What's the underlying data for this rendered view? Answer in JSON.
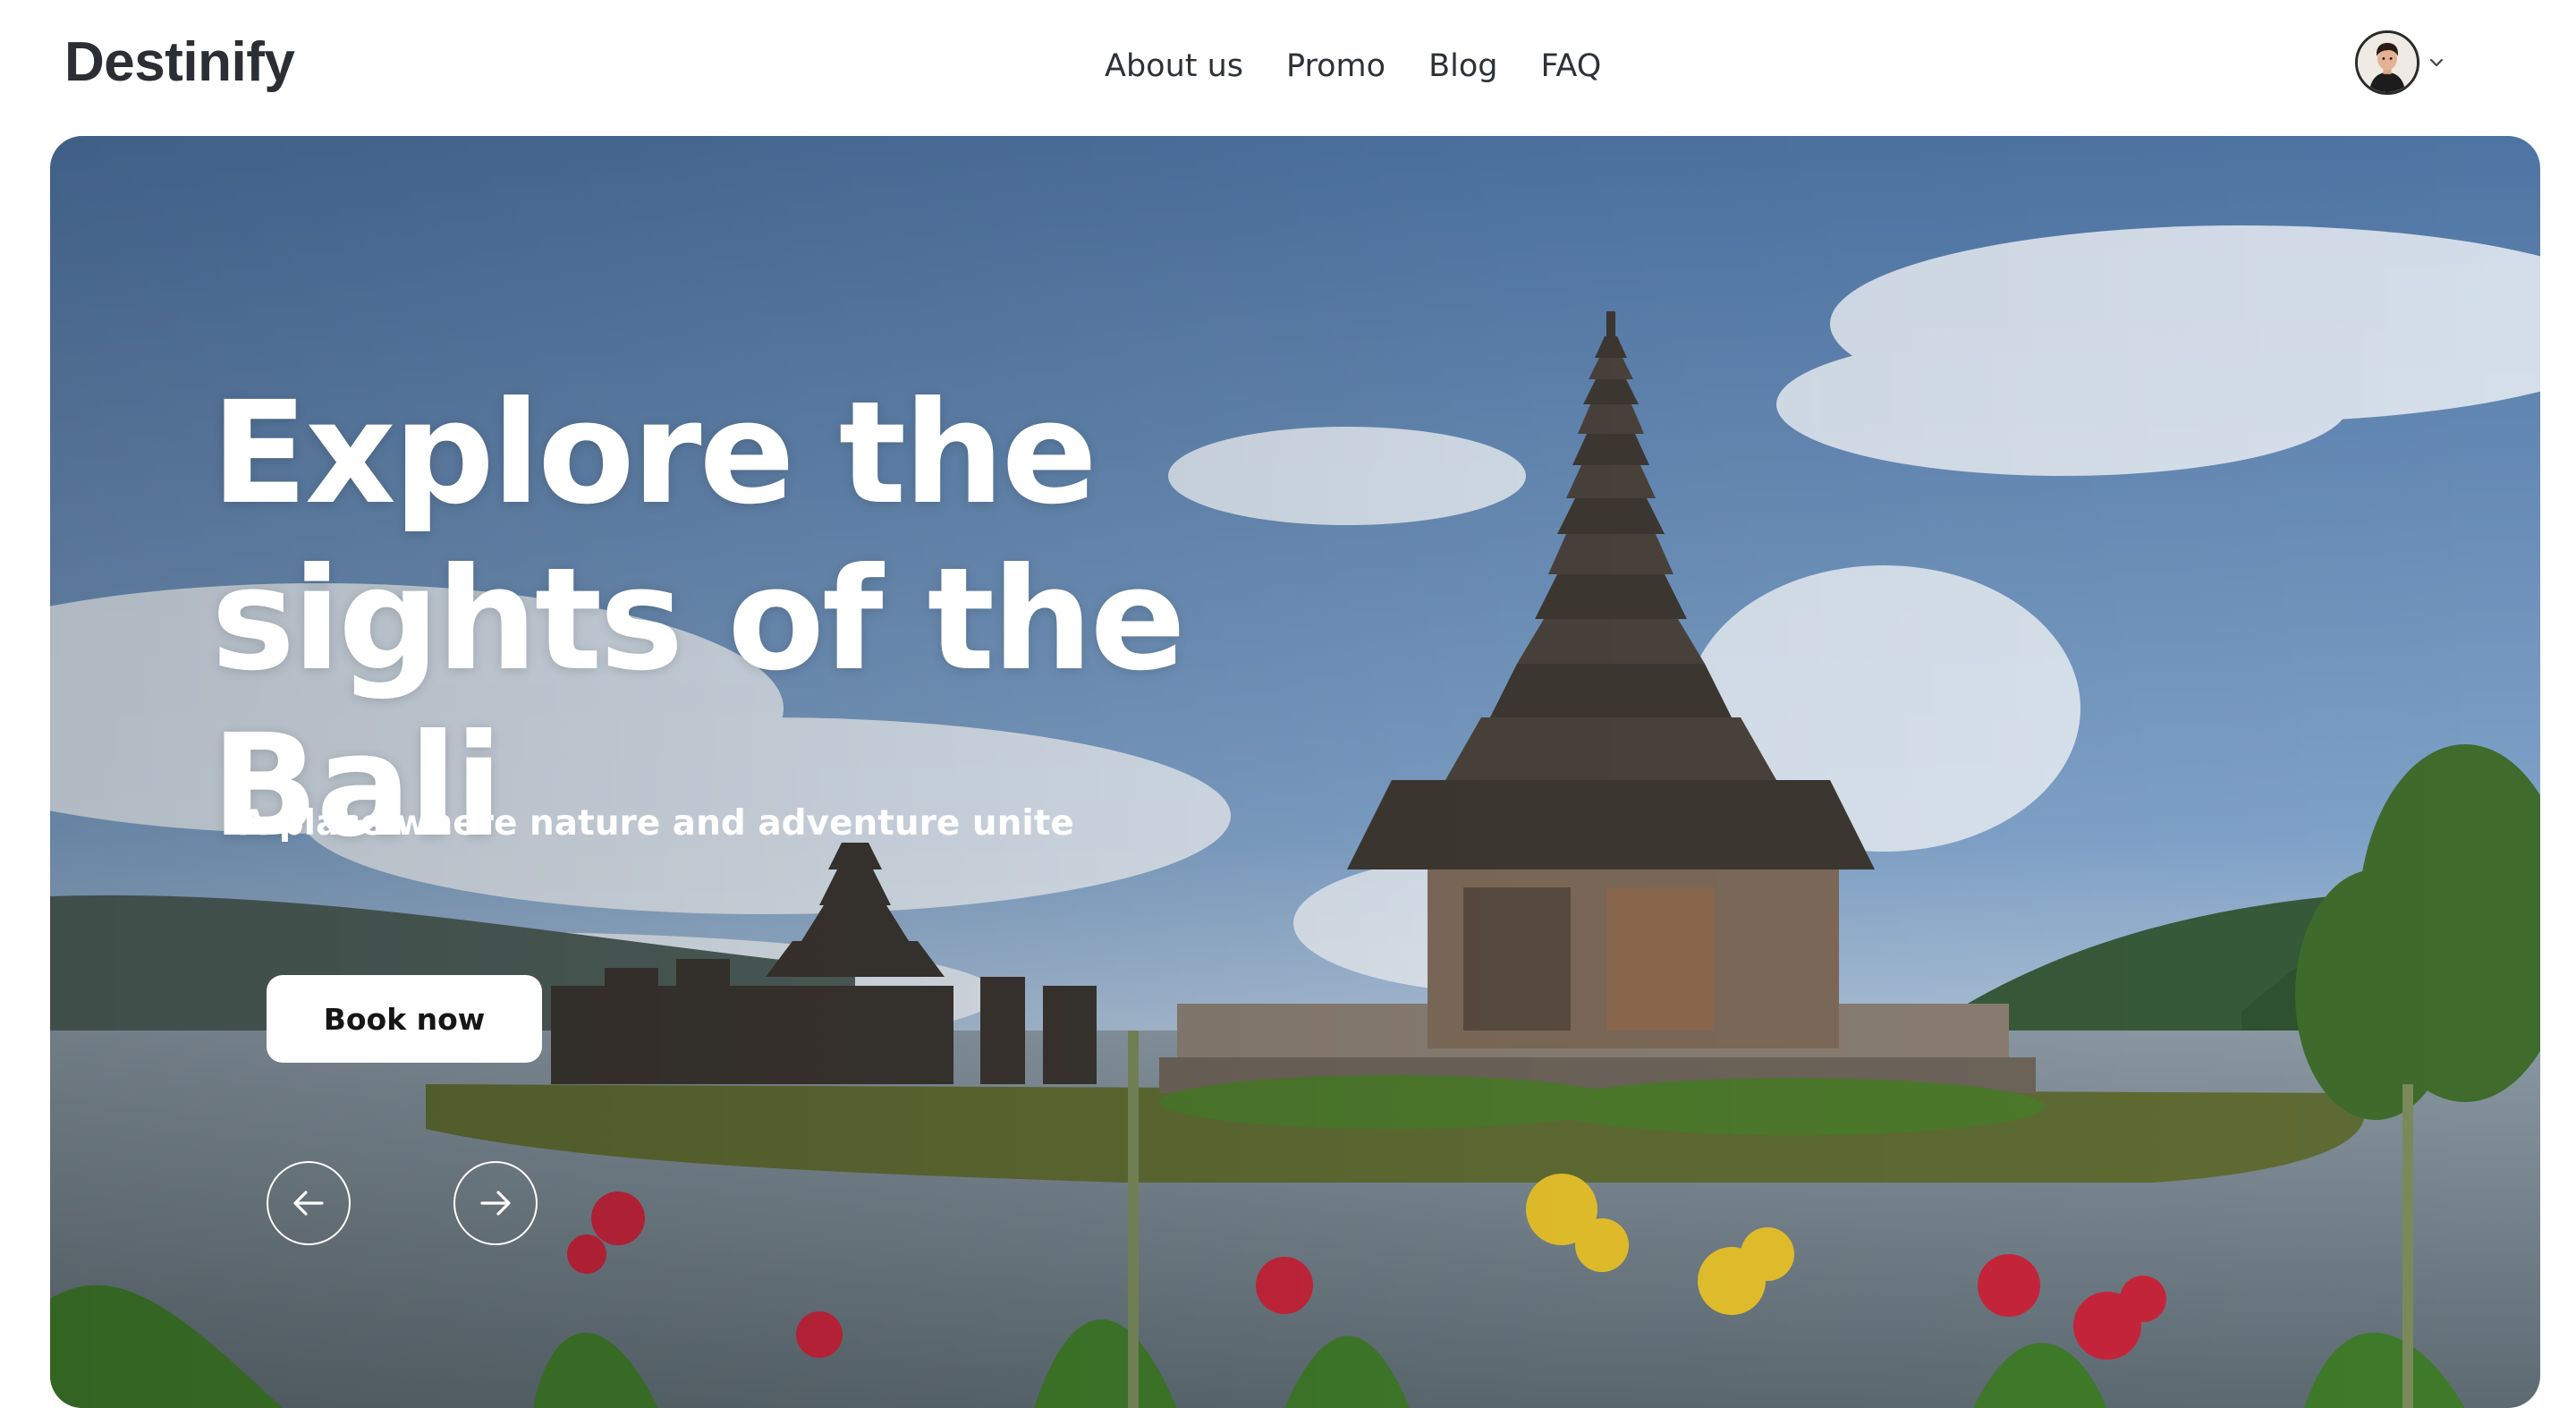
{
  "header": {
    "logo": "Destinify",
    "nav": [
      {
        "label": "About us"
      },
      {
        "label": "Promo"
      },
      {
        "label": "Blog"
      },
      {
        "label": "FAQ"
      }
    ],
    "user_menu": {
      "avatar_icon": "user-avatar",
      "dropdown_icon": "chevron-down-icon"
    }
  },
  "hero": {
    "title": "Explore the sights of the Bali",
    "subtitle": "A place where nature and adventure unite",
    "cta_label": "Book now",
    "prev_icon": "arrow-left-icon",
    "next_icon": "arrow-right-icon",
    "background": "photo-bali-lake-temple"
  },
  "colors": {
    "text_dark": "#2b2f33",
    "white": "#ffffff",
    "sky_top": "#4f76a4",
    "sky_bottom": "#8fb0d0",
    "water": "#7b8a94"
  }
}
